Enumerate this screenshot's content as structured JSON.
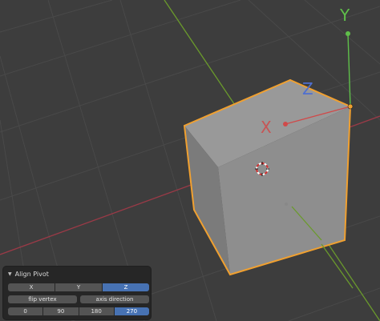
{
  "viewport": {
    "background": "#3d3d3d",
    "grid_color": "#474747",
    "x_axis_color": "#9a3a47",
    "y_axis_color": "#6a9a2c",
    "selection_outline_color": "#f0a030"
  },
  "gizmo": {
    "y_label": "Y",
    "z_label": "Z",
    "x_label": "X",
    "y_color": "#5fbf4a",
    "z_color": "#4f6fd0",
    "x_color": "#d04a4a"
  },
  "operator_panel": {
    "title": "Align Pivot",
    "axis_buttons": [
      {
        "label": "X",
        "active": false
      },
      {
        "label": "Y",
        "active": false
      },
      {
        "label": "Z",
        "active": true
      }
    ],
    "action_buttons": [
      {
        "label": "flip vertex"
      },
      {
        "label": "axis direction"
      }
    ],
    "angle_buttons": [
      {
        "label": "0",
        "active": false
      },
      {
        "label": "90",
        "active": false
      },
      {
        "label": "180",
        "active": false
      },
      {
        "label": "270",
        "active": true
      }
    ],
    "active_color": "#4772b3"
  }
}
